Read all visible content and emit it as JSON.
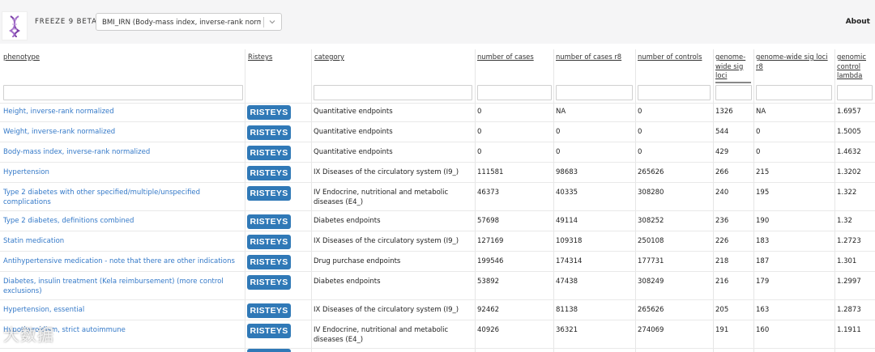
{
  "header": {
    "brand": "FREEZE 9 BETA",
    "select_value": "BMI_IRN (Body-mass index, inverse-rank norm...",
    "about": "About"
  },
  "columns": [
    "phenotype",
    "Risteys",
    "category",
    "number of cases",
    "number of cases r8",
    "number of controls",
    "genome-wide sig loci",
    "genome-wide sig loci r8",
    "genomic control lambda"
  ],
  "button_label": "RISTEYS",
  "rows": [
    {
      "phenotype": "Height, inverse-rank normalized",
      "category": "Quantitative endpoints",
      "cases": "0",
      "cases_r8": "NA",
      "controls": "0",
      "loci": "1326",
      "loci_r8": "NA",
      "lambda": "1.6957"
    },
    {
      "phenotype": "Weight, inverse-rank normalized",
      "category": "Quantitative endpoints",
      "cases": "0",
      "cases_r8": "0",
      "controls": "0",
      "loci": "544",
      "loci_r8": "0",
      "lambda": "1.5005"
    },
    {
      "phenotype": "Body-mass index, inverse-rank normalized",
      "category": "Quantitative endpoints",
      "cases": "0",
      "cases_r8": "0",
      "controls": "0",
      "loci": "429",
      "loci_r8": "0",
      "lambda": "1.4632"
    },
    {
      "phenotype": "Hypertension",
      "category": "IX Diseases of the circulatory system (I9_)",
      "cases": "111581",
      "cases_r8": "98683",
      "controls": "265626",
      "loci": "266",
      "loci_r8": "215",
      "lambda": "1.3202"
    },
    {
      "phenotype": "Type 2 diabetes with other specified/multiple/unspecified complications",
      "category": "IV Endocrine, nutritional and metabolic diseases (E4_)",
      "cases": "46373",
      "cases_r8": "40335",
      "controls": "308280",
      "loci": "240",
      "loci_r8": "195",
      "lambda": "1.322"
    },
    {
      "phenotype": "Type 2 diabetes, definitions combined",
      "category": "Diabetes endpoints",
      "cases": "57698",
      "cases_r8": "49114",
      "controls": "308252",
      "loci": "236",
      "loci_r8": "190",
      "lambda": "1.32"
    },
    {
      "phenotype": "Statin medication",
      "category": "IX Diseases of the circulatory system (I9_)",
      "cases": "127169",
      "cases_r8": "109318",
      "controls": "250108",
      "loci": "226",
      "loci_r8": "183",
      "lambda": "1.2723"
    },
    {
      "phenotype": "Antihypertensive medication - note that there are other indications",
      "category": "Drug purchase endpoints",
      "cases": "199546",
      "cases_r8": "174314",
      "controls": "177731",
      "loci": "218",
      "loci_r8": "187",
      "lambda": "1.301"
    },
    {
      "phenotype": "Diabetes, insulin treatment (Kela reimbursement) (more control exclusions)",
      "category": "Diabetes endpoints",
      "cases": "53892",
      "cases_r8": "47438",
      "controls": "308249",
      "loci": "216",
      "loci_r8": "179",
      "lambda": "1.2997"
    },
    {
      "phenotype": "Hypertension, essential",
      "category": "IX Diseases of the circulatory system (I9_)",
      "cases": "92462",
      "cases_r8": "81138",
      "controls": "265626",
      "loci": "205",
      "loci_r8": "163",
      "lambda": "1.2873"
    },
    {
      "phenotype": "Hypothyroidism, strict autoimmune",
      "category": "IV Endocrine, nutritional and metabolic diseases (E4_)",
      "cases": "40926",
      "cases_r8": "36321",
      "controls": "274069",
      "loci": "191",
      "loci_r8": "160",
      "lambda": "1.1911"
    }
  ],
  "watermark": "大数据"
}
